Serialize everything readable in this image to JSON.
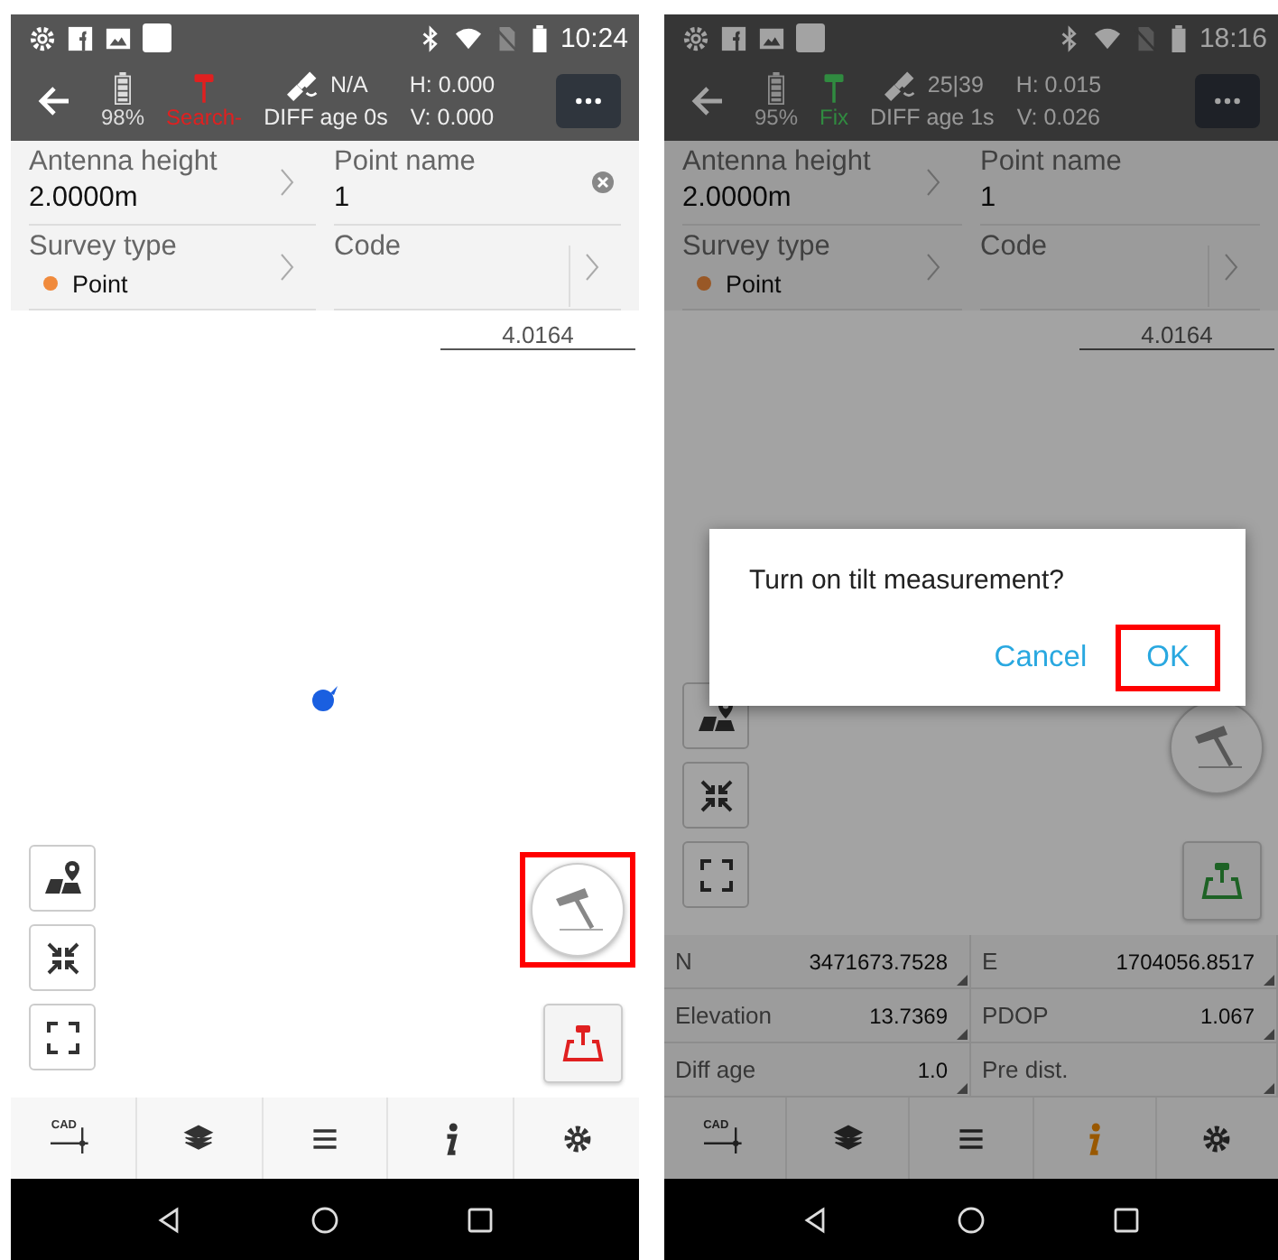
{
  "phones": [
    {
      "status_bar": {
        "time": "10:24"
      },
      "header": {
        "battery": "98%",
        "rtk_status": "Search-",
        "fixed": false,
        "satellites": "N/A",
        "diff_age": "DIFF age 0s",
        "h": "H: 0.000",
        "v": "V: 0.000"
      },
      "fields": [
        {
          "label": "Antenna height",
          "value": "2.0000m",
          "kind": "chevron"
        },
        {
          "label": "Point name",
          "value": "1",
          "kind": "clear"
        },
        {
          "label": "Survey type",
          "value": "Point",
          "kind": "dot"
        },
        {
          "label": "Code",
          "kind": "split"
        }
      ],
      "scale": "4.0164",
      "location_marker": true,
      "tilt_button": {
        "highlighted": true
      },
      "toolbar": [
        {
          "kind": "cad",
          "label": "CAD",
          "selected": false
        },
        {
          "kind": "layers",
          "selected": false
        },
        {
          "kind": "menu",
          "selected": false
        },
        {
          "kind": "info",
          "selected": false
        },
        {
          "kind": "settings",
          "selected": false
        }
      ]
    },
    {
      "status_bar": {
        "time": "18:16"
      },
      "header": {
        "battery": "95%",
        "rtk_status": "Fix",
        "fixed": true,
        "satellites": "25|39",
        "diff_age": "DIFF age 1s",
        "h": "H: 0.015",
        "v": "V: 0.026"
      },
      "fields": [
        {
          "label": "Antenna height",
          "value": "2.0000m",
          "kind": "chevron"
        },
        {
          "label": "Point name",
          "value": "1",
          "kind": "plain"
        },
        {
          "label": "Survey type",
          "value": "Point",
          "kind": "dot"
        },
        {
          "label": "Code",
          "kind": "split"
        }
      ],
      "scale": "4.0164",
      "location_marker": false,
      "tilt_button": {
        "highlighted": false
      },
      "data_grid": [
        {
          "label": "N",
          "value": "3471673.7528"
        },
        {
          "label": "E",
          "value": "1704056.8517"
        },
        {
          "label": "Elevation",
          "value": "13.7369"
        },
        {
          "label": "PDOP",
          "value": "1.067"
        },
        {
          "label": "Diff age",
          "value": "1.0"
        },
        {
          "label": "Pre dist."
        }
      ],
      "toolbar": [
        {
          "kind": "cad",
          "label": "CAD",
          "selected": false
        },
        {
          "kind": "layers",
          "selected": false
        },
        {
          "kind": "menu",
          "selected": false
        },
        {
          "kind": "info",
          "selected": true
        },
        {
          "kind": "settings",
          "selected": false
        }
      ],
      "dialog": {
        "message": "Turn on tilt measurement?",
        "buttons": [
          {
            "label": "Cancel",
            "highlighted": false
          },
          {
            "label": "OK",
            "highlighted": true
          }
        ]
      }
    }
  ]
}
